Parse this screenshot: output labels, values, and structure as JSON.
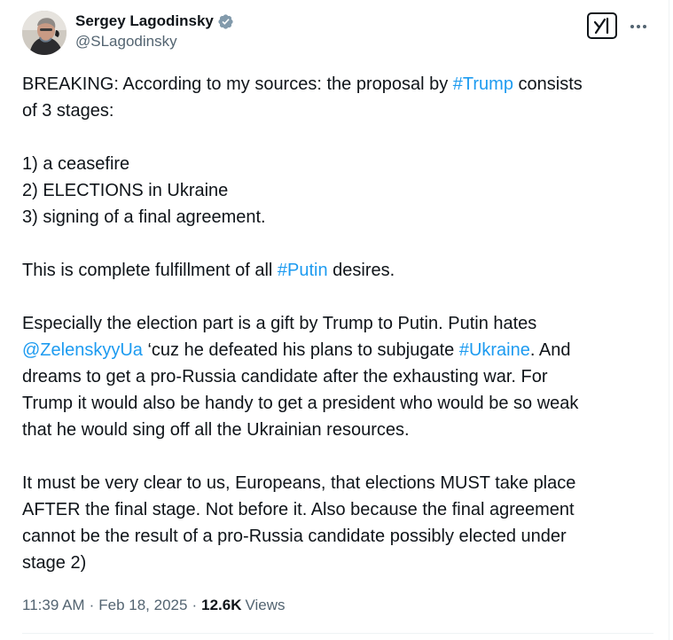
{
  "author": {
    "display_name": "Sergey Lagodinsky",
    "handle": "@SLagodinsky",
    "verified": true
  },
  "tweet": {
    "paragraphs": [
      [
        [
          {
            "text": "BREAKING: According to my sources: the proposal by "
          },
          {
            "text": "#Trump",
            "link": true
          },
          {
            "text": " consists"
          }
        ],
        [
          {
            "text": "of 3 stages:"
          }
        ]
      ],
      [
        [
          {
            "text": "1) a ceasefire"
          }
        ],
        [
          {
            "text": "2) ELECTIONS in Ukraine"
          }
        ],
        [
          {
            "text": "3) signing of a final agreement."
          }
        ]
      ],
      [
        [
          {
            "text": "This is complete fulfillment of all "
          },
          {
            "text": "#Putin",
            "link": true
          },
          {
            "text": " desires."
          }
        ]
      ],
      [
        [
          {
            "text": "Especially the election part is a gift by Trump to Putin. Putin hates"
          }
        ],
        [
          {
            "text": "@ZelenskyyUa",
            "link": true
          },
          {
            "text": " ‘cuz he defeated his plans to subjugate "
          },
          {
            "text": "#Ukraine",
            "link": true
          },
          {
            "text": ". And"
          }
        ],
        [
          {
            "text": "dreams to get a pro-Russia candidate after the exhausting war. For"
          }
        ],
        [
          {
            "text": "Trump it would also be handy to get a president who would be so weak"
          }
        ],
        [
          {
            "text": "that he would sing off all the Ukrainian resources."
          }
        ]
      ],
      [
        [
          {
            "text": "It must be very clear to us, Europeans, that elections MUST take place"
          }
        ],
        [
          {
            "text": "AFTER the final stage. Not before it. Also because the final agreement"
          }
        ],
        [
          {
            "text": "cannot be the result of a pro-Russia candidate possibly elected under"
          }
        ],
        [
          {
            "text": "stage 2)"
          }
        ]
      ]
    ]
  },
  "meta": {
    "time": "11:39 AM",
    "separator": "·",
    "date": "Feb 18, 2025",
    "views_count": "12.6K",
    "views_label": "Views"
  },
  "icons": {
    "verified": "verified-badge-icon",
    "grok": "grok-icon",
    "more": "more-options-icon"
  },
  "colors": {
    "text": "#0f1419",
    "secondary": "#536471",
    "link": "#1d9bf0",
    "verified_badge": "#829aab"
  }
}
